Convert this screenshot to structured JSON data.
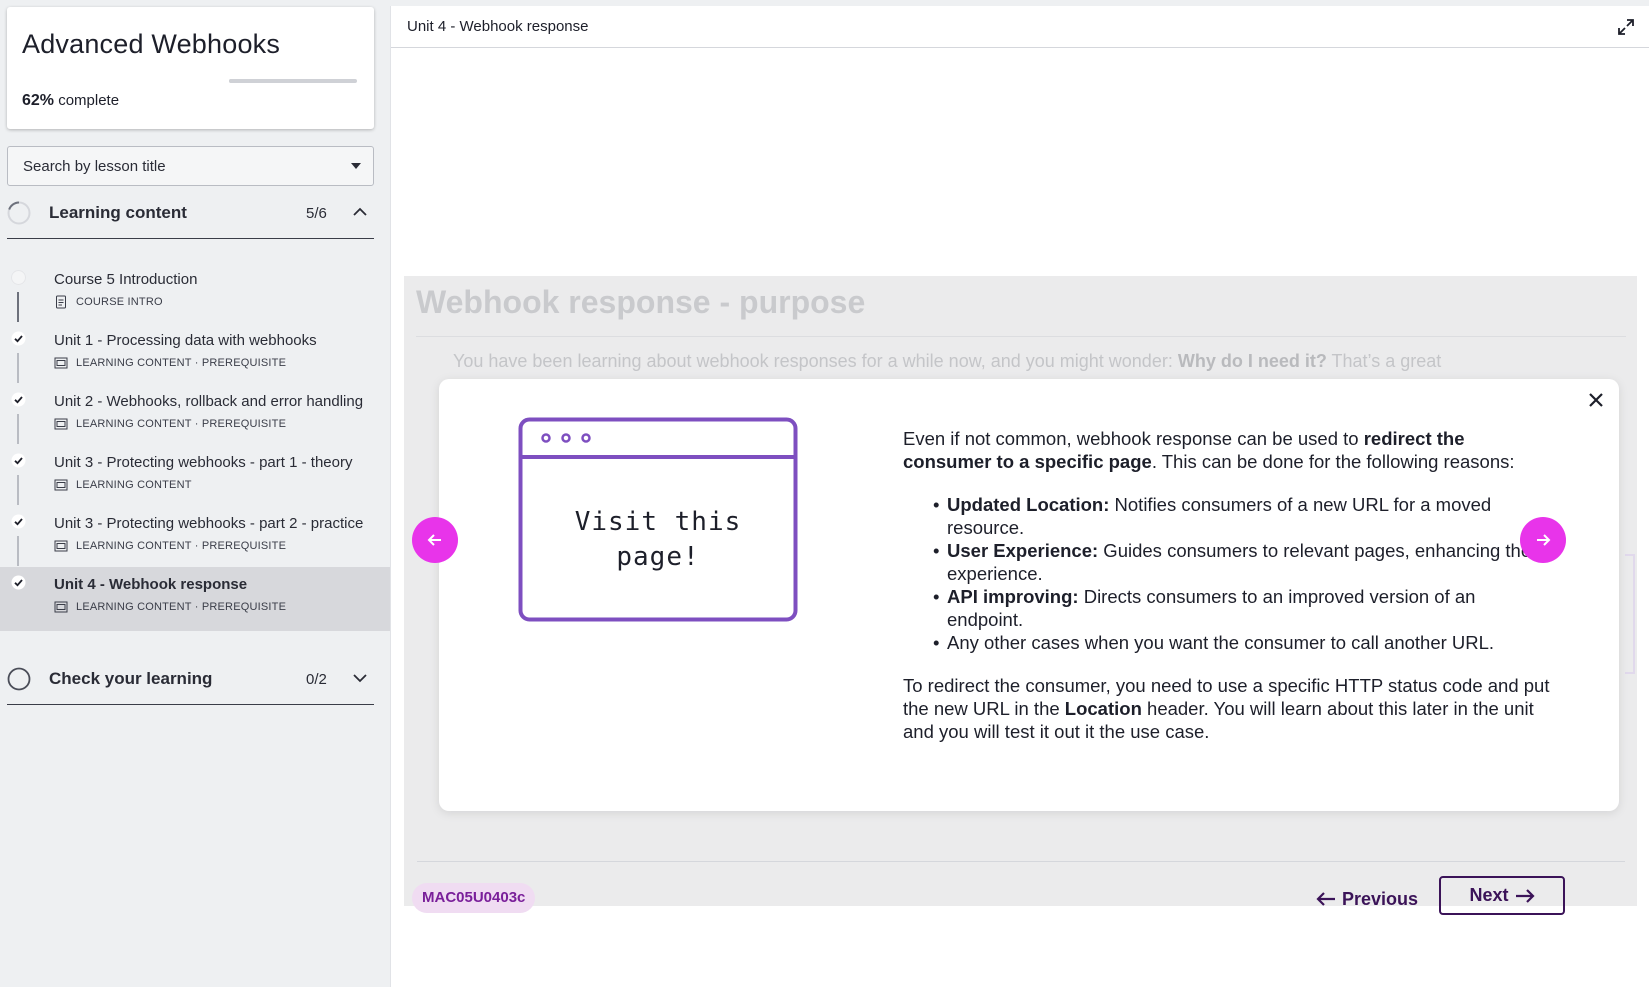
{
  "sidebar": {
    "course_title": "Advanced Webhooks",
    "progress_percent": "62%",
    "progress_label": " complete",
    "progress_fraction": 0.62,
    "search_placeholder": "Search by lesson title",
    "sections": [
      {
        "title": "Learning content",
        "count": "5/6",
        "expanded": true
      },
      {
        "title": "Check your learning",
        "count": "0/2",
        "expanded": false
      }
    ],
    "lessons": [
      {
        "title": "Course 5 Introduction",
        "type": "COURSE INTRO",
        "status": "not-started"
      },
      {
        "title": "Unit 1 - Processing data with webhooks",
        "type": "LEARNING CONTENT · PREREQUISITE",
        "status": "complete"
      },
      {
        "title": "Unit 2 - Webhooks, rollback and error handling",
        "type": "LEARNING CONTENT · PREREQUISITE",
        "status": "complete"
      },
      {
        "title": "Unit 3 - Protecting webhooks - part 1 - theory",
        "type": "LEARNING CONTENT",
        "status": "complete"
      },
      {
        "title": "Unit 3 - Protecting webhooks - part 2 - practice",
        "type": "LEARNING CONTENT · PREREQUISITE",
        "status": "complete"
      },
      {
        "title": "Unit 4 - Webhook response",
        "type": "LEARNING CONTENT · PREREQUISITE",
        "status": "complete",
        "active": true
      }
    ]
  },
  "main": {
    "unit_title": "Unit 4 - Webhook response",
    "background": {
      "title": "Webhook response - purpose",
      "text_before": "You have been learning about webhook responses for a while now, and you might wonder: ",
      "text_bold": "Why do I need it?",
      "text_after": " That’s a great"
    },
    "modal": {
      "illustration_line1": "Visit this",
      "illustration_line2": "page!",
      "intro_before": "Even if not common, webhook response can be used to ",
      "intro_bold": "redirect the consumer to a specific page",
      "intro_after": ". This can be done for the following reasons:",
      "bullets": [
        {
          "bold": "Updated Location:",
          "text": " Notifies consumers of a new URL for a moved resource."
        },
        {
          "bold": "User Experience:",
          "text": " Guides consumers to relevant pages, enhancing their experience."
        },
        {
          "bold": "API improving:",
          "text": " Directs consumers to an improved version of an endpoint."
        },
        {
          "bold": "",
          "text": "Any other cases when you want the consumer to call another URL."
        }
      ],
      "outro_before": "To redirect the consumer, you need to use a specific HTTP status code and put the new URL in the ",
      "outro_bold": "Location",
      "outro_after": " header. You will learn about this later in the unit and you will test it out it the use case."
    },
    "footer": {
      "code": "MAC05U0403c",
      "previous_label": "Previous",
      "next_label": "Next"
    }
  },
  "colors": {
    "accent_magenta": "#e834ea",
    "illustration_purple": "#7e4fc0",
    "nav_text": "#3b1358",
    "badge_bg": "#f0dcf2"
  }
}
